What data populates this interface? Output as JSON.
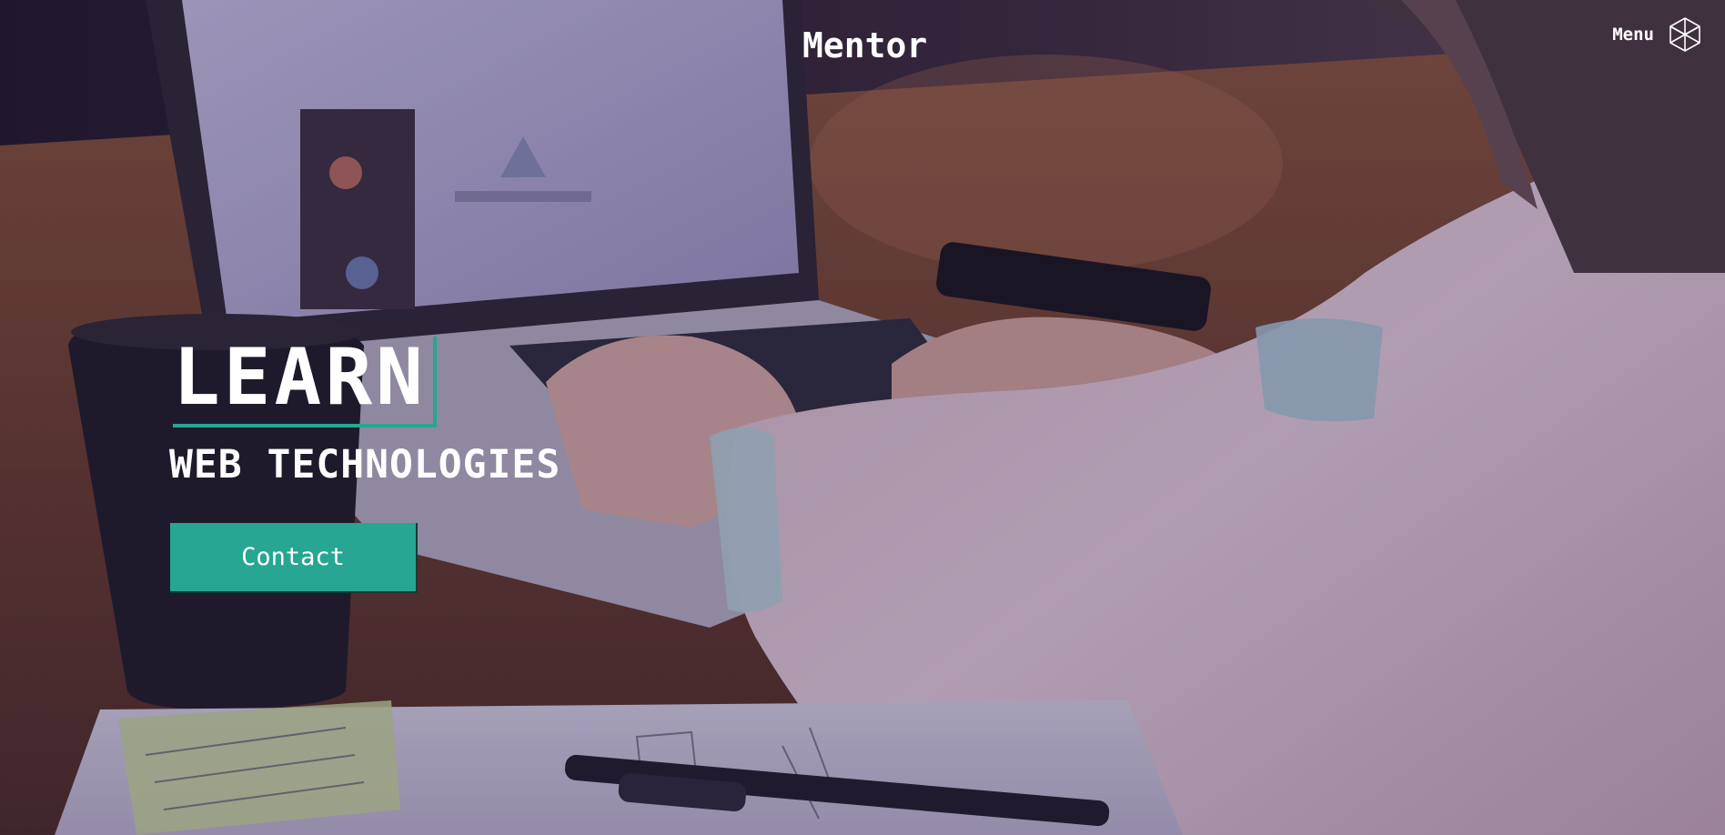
{
  "header": {
    "brand": "Mentor",
    "menu_label": "Menu",
    "menu_icon": "hexagon-wireframe-icon"
  },
  "hero": {
    "headline": "LEARN",
    "subheadline": "WEB TECHNOLOGIES",
    "cta_label": "Contact"
  },
  "colors": {
    "accent": "#26a693",
    "text": "#ffffff",
    "overlay": "#281c46"
  }
}
